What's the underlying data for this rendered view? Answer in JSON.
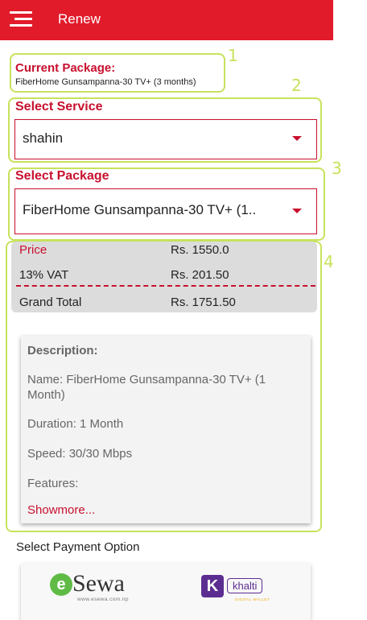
{
  "appbar": {
    "title": "Renew"
  },
  "current_package": {
    "label": "Current Package:",
    "value": "FiberHome Gunsampanna-30 TV+ (3 months)"
  },
  "service": {
    "label": "Select Service",
    "value": "shahin"
  },
  "package": {
    "label": "Select Package",
    "value": "FiberHome Gunsampanna-30 TV+ (1.."
  },
  "annotations": [
    "1",
    "2",
    "3",
    "4"
  ],
  "pricing": {
    "price_label": "Price",
    "price_value": "Rs. 1550.0",
    "vat_label": "13% VAT",
    "vat_value": "Rs. 201.50",
    "total_label": "Grand Total",
    "total_value": "Rs. 1751.50"
  },
  "description": {
    "heading": "Description:",
    "name_line1": "Name: FiberHome Gunsampanna-30 TV+ (1",
    "name_line2": "Month)",
    "duration": "Duration: 1 Month",
    "speed": "Speed: 30/30 Mbps",
    "features": "Features:",
    "show_more": "Showmore..."
  },
  "payment": {
    "label": "Select Payment Option",
    "esewa_brand": "Sewa",
    "esewa_url": "www.esewa.com.np",
    "khalti_brand": "khalti",
    "khalti_tagline": "DIGITAL WALLET"
  },
  "colors": {
    "primary_red": "#e21b2b",
    "annotation_green": "#c7e25c",
    "esewa_green": "#60bb46",
    "khalti_purple": "#5c2d91"
  }
}
